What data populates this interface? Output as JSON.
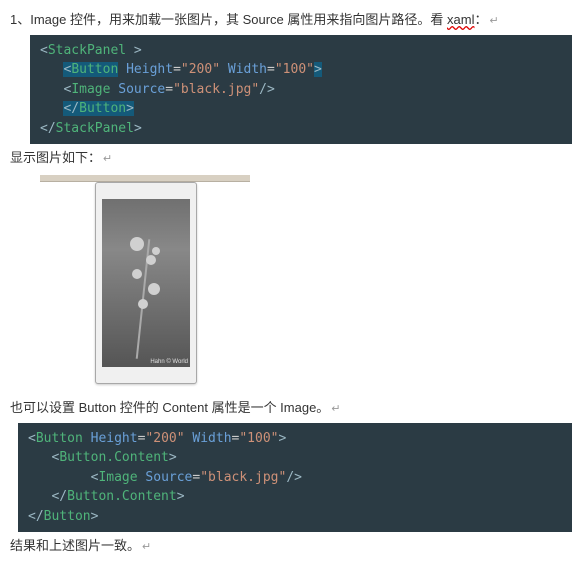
{
  "line1": {
    "num": "1、",
    "a": "Image 控件，用来加载一张图片，其 Source 属性用来指向图片路径。看 ",
    "b": "xaml",
    "c": "："
  },
  "code1": {
    "l1a": "<",
    "l1b": "StackPanel",
    "l1c": " >",
    "l2a": "   ",
    "l2hl_open": "<",
    "l2hl_name": "Button",
    "l2_sp1": " ",
    "l2_attr1": "Height",
    "l2_eq1": "=",
    "l2_val1": "\"200\"",
    "l2_sp2": " ",
    "l2_attr2": "Width",
    "l2_eq2": "=",
    "l2_val2": "\"100\"",
    "l2_close": ">",
    "l3a": "   <",
    "l3b": "Image",
    "l3sp": " ",
    "l3attr": "Source",
    "l3eq": "=",
    "l3val": "\"black.jpg\"",
    "l3end": "/>",
    "l4a": "   ",
    "l4hl_open": "</",
    "l4hl_name": "Button",
    "l4hl_close": ">",
    "l5a": "</",
    "l5b": "StackPanel",
    "l5c": ">"
  },
  "line2": "显示图片如下：",
  "line3": "也可以设置 Button 控件的 Content 属性是一个 Image。",
  "code2": {
    "l1a": "<",
    "l1b": "Button",
    "l1sp1": " ",
    "l1attr1": "Height",
    "l1eq1": "=",
    "l1val1": "\"200\"",
    "l1sp2": " ",
    "l1attr2": "Width",
    "l1eq2": "=",
    "l1val2": "\"100\"",
    "l1end": ">",
    "l2a": "   <",
    "l2b": "Button.Content",
    "l2c": ">",
    "l3a": "        <",
    "l3b": "Image",
    "l3sp": " ",
    "l3attr": "Source",
    "l3eq": "=",
    "l3val": "\"black.jpg\"",
    "l3end": "/>",
    "l4a": "   </",
    "l4b": "Button.Content",
    "l4c": ">",
    "l5a": "</",
    "l5b": "Button",
    "l5c": ">"
  },
  "line4": "结果和上述图片一致。",
  "crlf": "↵"
}
